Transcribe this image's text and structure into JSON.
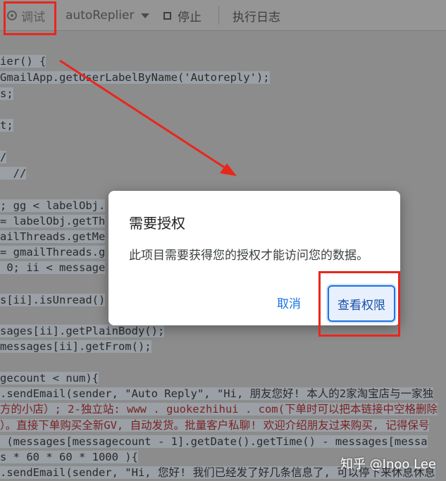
{
  "toolbar": {
    "debug_label": "调试",
    "function_name": "autoReplier",
    "stop_label": "停止",
    "log_label": "执行日志"
  },
  "code": {
    "lines": [
      "ier() {",
      "GmailApp.getUserLabelByName('Autoreply');",
      "s;",
      "",
      "t;",
      "",
      "/",
      "  //",
      "",
      "; gg < labelObj.",
      "= labelObj.getTh",
      "ailThreads.getMe",
      "= gmailThreads.g",
      " 0; ii < message",
      "",
      "s[ii].isUnread()",
      "",
      "sages[ii].getPlainBody();",
      "messages[ii].getFrom();",
      "",
      "gecount < num){",
      ".sendEmail(sender, \"Auto Reply\", \"Hi, 朋友您好! 本人的2家淘宝店与一家独",
      "方的小店）; 2-独立站: www . guokezhihui . com(下单时可以把本链接中空格删除",
      "）。直接下单购买全新GV, 自动发货。批量客户私聊! 欢迎介绍朋友过来购买, 记得保号",
      " (messages[messagecount - 1].getDate().getTime() - messages[messa",
      "s * 60 * 60 * 1000 ){",
      ".sendEmail(sender, \"Hi, 您好! 我们已经发了好几条信息了, 可以停下来休息休息"
    ]
  },
  "dialog": {
    "title": "需要授权",
    "message": "此项目需要获得您的授权才能访问您的数据。",
    "cancel_label": "取消",
    "review_label": "查看权限"
  },
  "watermark": "知乎 @Inoo Lee",
  "colors": {
    "overlay": "#8c8c8c",
    "annotation_red": "#e8271c",
    "primary_blue": "#1a73e8"
  }
}
